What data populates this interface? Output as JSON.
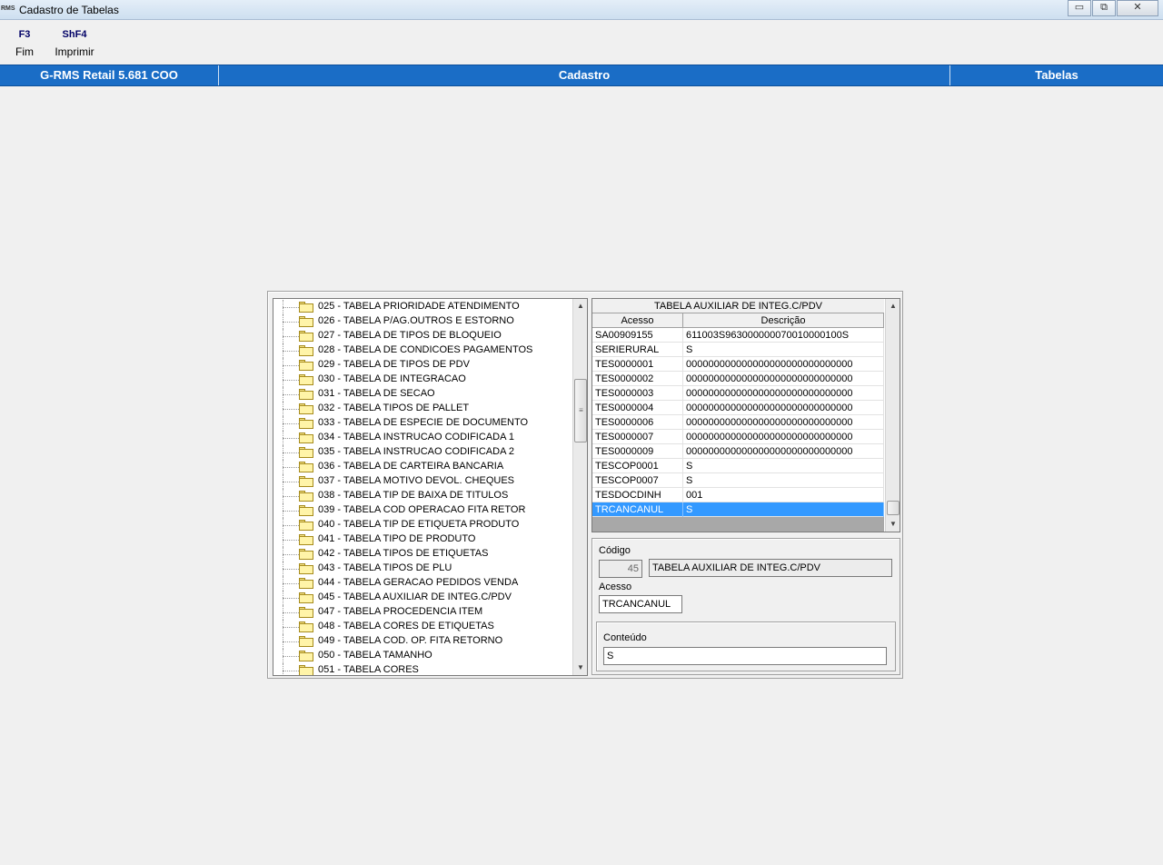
{
  "window": {
    "title": "Cadastro de Tabelas",
    "app_icon_text": "RMS",
    "minimize": "▭",
    "restore": "⧉",
    "close": "✕"
  },
  "fkeys": [
    {
      "key": "F3",
      "label": "Fim"
    },
    {
      "key": "ShF4",
      "label": "Imprimir"
    }
  ],
  "header": {
    "app": "G-RMS Retail 5.681 COO",
    "module": "Cadastro",
    "screen": "Tabelas"
  },
  "tree": {
    "items": [
      "025 - TABELA PRIORIDADE ATENDIMENTO",
      "026 - TABELA P/AG.OUTROS E ESTORNO",
      "027 - TABELA DE TIPOS DE BLOQUEIO",
      "028 - TABELA DE CONDICOES PAGAMENTOS",
      "029 - TABELA DE TIPOS DE PDV",
      "030 - TABELA DE INTEGRACAO",
      "031 - TABELA DE SECAO",
      "032 - TABELA TIPOS DE PALLET",
      "033 - TABELA DE ESPECIE DE DOCUMENTO",
      "034 - TABELA INSTRUCAO CODIFICADA 1",
      "035 - TABELA INSTRUCAO CODIFICADA 2",
      "036 - TABELA DE CARTEIRA BANCARIA",
      "037 - TABELA MOTIVO DEVOL. CHEQUES",
      "038 - TABELA TIP DE BAIXA DE TITULOS",
      "039 - TABELA COD OPERACAO FITA RETOR",
      "040 - TABELA TIP DE ETIQUETA PRODUTO",
      "041 - TABELA TIPO DE PRODUTO",
      "042 - TABELA TIPOS DE ETIQUETAS",
      "043 - TABELA TIPOS DE PLU",
      "044 - TABELA GERACAO PEDIDOS VENDA",
      "045 - TABELA AUXILIAR DE INTEG.C/PDV",
      "047 - TABELA PROCEDENCIA ITEM",
      "048 - TABELA CORES DE ETIQUETAS",
      "049 - TABELA COD. OP. FITA RETORNO",
      "050 - TABELA TAMANHO",
      "051 - TABELA CORES"
    ]
  },
  "grid": {
    "title": "TABELA AUXILIAR DE INTEG.C/PDV",
    "columns": [
      "Acesso",
      "Descrição"
    ],
    "rows": [
      [
        "SA00909155",
        "611003S963000000070010000100S"
      ],
      [
        "SERIERURAL",
        "S"
      ],
      [
        "TES0000001",
        "000000000000000000000000000000"
      ],
      [
        "TES0000002",
        "000000000000000000000000000000"
      ],
      [
        "TES0000003",
        "000000000000000000000000000000"
      ],
      [
        "TES0000004",
        "000000000000000000000000000000"
      ],
      [
        "TES0000006",
        "000000000000000000000000000000"
      ],
      [
        "TES0000007",
        "000000000000000000000000000000"
      ],
      [
        "TES0000009",
        "000000000000000000000000000000"
      ],
      [
        "TESCOP0001",
        "S"
      ],
      [
        "TESCOP0007",
        "S"
      ],
      [
        "TESDOCDINH",
        "001"
      ],
      [
        "TRCANCANUL",
        "S"
      ]
    ],
    "selected_index": 12
  },
  "form": {
    "codigo_label": "Código",
    "codigo_value": "45",
    "codigo_desc": "TABELA AUXILIAR DE INTEG.C/PDV",
    "acesso_label": "Acesso",
    "acesso_value": "TRCANCANUL",
    "conteudo_label": "Conteúdo",
    "conteudo_value": "S"
  },
  "scroll_arrows": {
    "up": "▲",
    "down": "▼",
    "grip": "≡"
  },
  "colors": {
    "header_bg": "#1a6dc6",
    "selection": "#3399ff",
    "folder": "#fff4a8"
  }
}
